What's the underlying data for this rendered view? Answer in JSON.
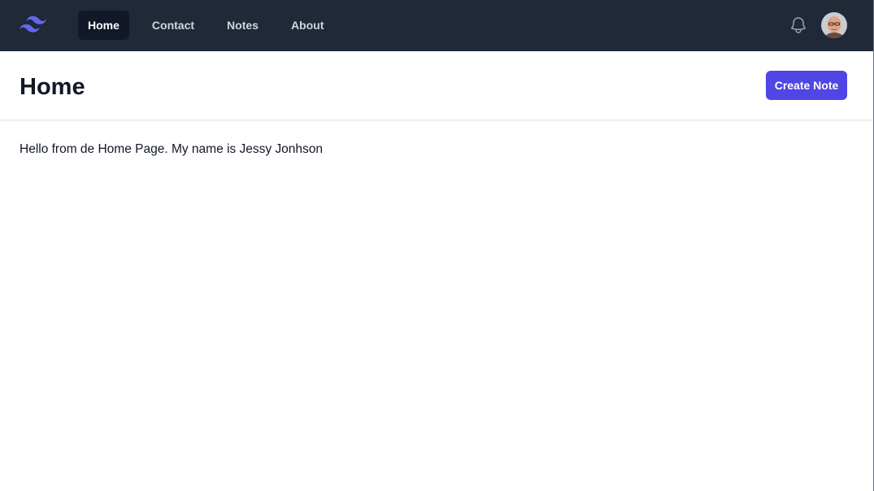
{
  "nav": {
    "logo_icon": "tailwind-waves-icon",
    "links": [
      {
        "label": "Home",
        "active": true
      },
      {
        "label": "Contact",
        "active": false
      },
      {
        "label": "Notes",
        "active": false
      },
      {
        "label": "About",
        "active": false
      }
    ],
    "notification_icon": "bell-icon",
    "avatar_icon": "user-avatar"
  },
  "header": {
    "title": "Home",
    "create_label": "Create Note"
  },
  "main": {
    "text": "Hello from de Home Page. My name is Jessy Jonhson"
  },
  "colors": {
    "navbar_bg": "#1f2937",
    "active_link_bg": "#111827",
    "accent": "#4f46e5",
    "logo": "#6366f1"
  }
}
